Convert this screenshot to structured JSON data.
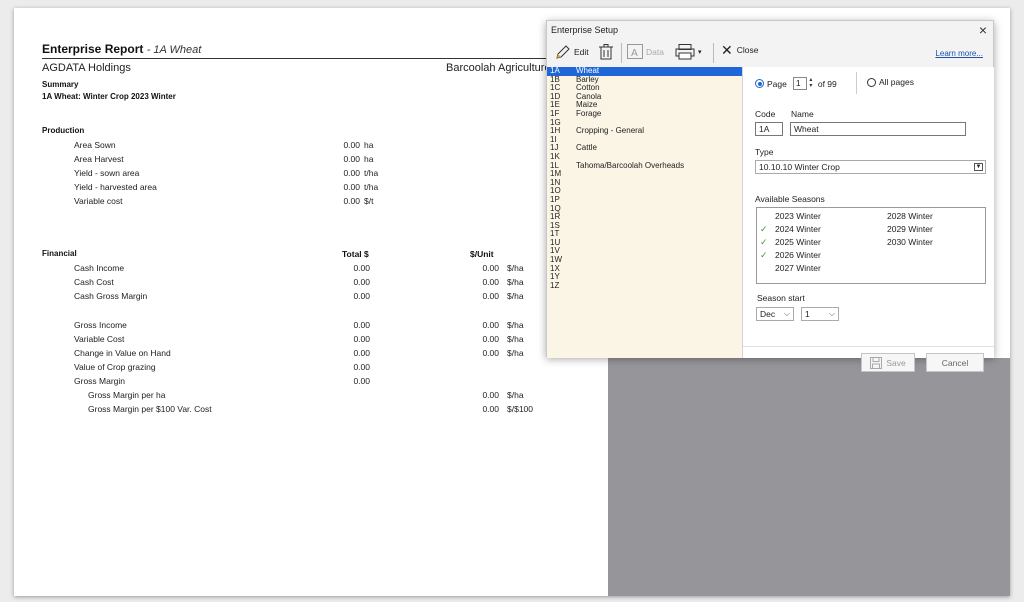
{
  "report": {
    "title": "Enterprise Report",
    "subtitle": "- 1A Wheat",
    "company": "AGDATA Holdings",
    "company_right": "Barcoolah Agriculture",
    "summary_label": "Summary",
    "summary_line": "1A Wheat: Winter Crop 2023 Winter",
    "production_label": "Production",
    "production_rows": [
      {
        "label": "Area Sown",
        "value": "0.00",
        "unit": "ha"
      },
      {
        "label": "Area Harvest",
        "value": "0.00",
        "unit": "ha"
      },
      {
        "label": "Yield - sown area",
        "value": "0.00",
        "unit": "t/ha"
      },
      {
        "label": "Yield - harvested area",
        "value": "0.00",
        "unit": "t/ha"
      },
      {
        "label": "Variable cost",
        "value": "0.00",
        "unit": "$/t"
      }
    ],
    "financial_label": "Financial",
    "col_total": "Total $",
    "col_unit": "$/Unit",
    "financial_rows": [
      {
        "label": "Cash Income",
        "total": "0.00",
        "per": "0.00",
        "unit": "$/ha"
      },
      {
        "label": "Cash Cost",
        "total": "0.00",
        "per": "0.00",
        "unit": "$/ha"
      },
      {
        "label": "Cash Gross Margin",
        "total": "0.00",
        "per": "0.00",
        "unit": "$/ha"
      },
      {
        "label": "Gross Income",
        "total": "0.00",
        "per": "0.00",
        "unit": "$/ha"
      },
      {
        "label": "Variable Cost",
        "total": "0.00",
        "per": "0.00",
        "unit": "$/ha"
      },
      {
        "label": "Change in Value on Hand",
        "total": "0.00",
        "per": "0.00",
        "unit": "$/ha"
      },
      {
        "label": "Value of Crop grazing",
        "total": "0.00",
        "per": "",
        "unit": ""
      },
      {
        "label": "Gross Margin",
        "total": "0.00",
        "per": "",
        "unit": ""
      },
      {
        "label": "Gross Margin per ha",
        "total": "",
        "per": "0.00",
        "unit": "$/ha"
      },
      {
        "label": "Gross Margin per $100 Var. Cost",
        "total": "",
        "per": "0.00",
        "unit": "$/$100"
      }
    ]
  },
  "dialog": {
    "title": "Enterprise Setup",
    "toolbar": {
      "edit": "Edit",
      "data": "Data",
      "close": "Close",
      "learn_more": "Learn more..."
    },
    "enterprises": [
      {
        "code": "1A",
        "name": "Wheat",
        "selected": true
      },
      {
        "code": "1B",
        "name": "Barley"
      },
      {
        "code": "1C",
        "name": "Cotton"
      },
      {
        "code": "1D",
        "name": "Canola"
      },
      {
        "code": "1E",
        "name": "Maize"
      },
      {
        "code": "1F",
        "name": "Forage"
      },
      {
        "code": "1G",
        "name": ""
      },
      {
        "code": "1H",
        "name": "Cropping - General"
      },
      {
        "code": "1I",
        "name": ""
      },
      {
        "code": "1J",
        "name": "Cattle"
      },
      {
        "code": "1K",
        "name": ""
      },
      {
        "code": "1L",
        "name": "Tahoma/Barcoolah Overheads"
      },
      {
        "code": "1M",
        "name": ""
      },
      {
        "code": "1N",
        "name": ""
      },
      {
        "code": "1O",
        "name": ""
      },
      {
        "code": "1P",
        "name": ""
      },
      {
        "code": "1Q",
        "name": ""
      },
      {
        "code": "1R",
        "name": ""
      },
      {
        "code": "1S",
        "name": ""
      },
      {
        "code": "1T",
        "name": ""
      },
      {
        "code": "1U",
        "name": ""
      },
      {
        "code": "1V",
        "name": ""
      },
      {
        "code": "1W",
        "name": ""
      },
      {
        "code": "1X",
        "name": ""
      },
      {
        "code": "1Y",
        "name": ""
      },
      {
        "code": "1Z",
        "name": ""
      }
    ],
    "page_label": "Page",
    "page_value": "1",
    "of_pages": "of 99",
    "all_pages": "All pages",
    "code_label": "Code",
    "name_label": "Name",
    "code_value": "1A",
    "name_value": "Wheat",
    "type_label": "Type",
    "type_value": "10.10.10 Winter Crop",
    "seasons_label": "Available Seasons",
    "seasons_col1": [
      {
        "name": "2023 Winter",
        "checked": false
      },
      {
        "name": "2024 Winter",
        "checked": true
      },
      {
        "name": "2025 Winter",
        "checked": true
      },
      {
        "name": "2026 Winter",
        "checked": true
      },
      {
        "name": "2027 Winter",
        "checked": false
      }
    ],
    "seasons_col2": [
      {
        "name": "2028 Winter"
      },
      {
        "name": "2029 Winter"
      },
      {
        "name": "2030 Winter"
      }
    ],
    "season_start_label": "Season start",
    "season_month": "Dec",
    "season_day": "1",
    "save": "Save",
    "cancel": "Cancel",
    "colors": {
      "selection": "#1f67d6",
      "list_bg": "#fbf5e6",
      "check": "#3a9a3a"
    }
  }
}
